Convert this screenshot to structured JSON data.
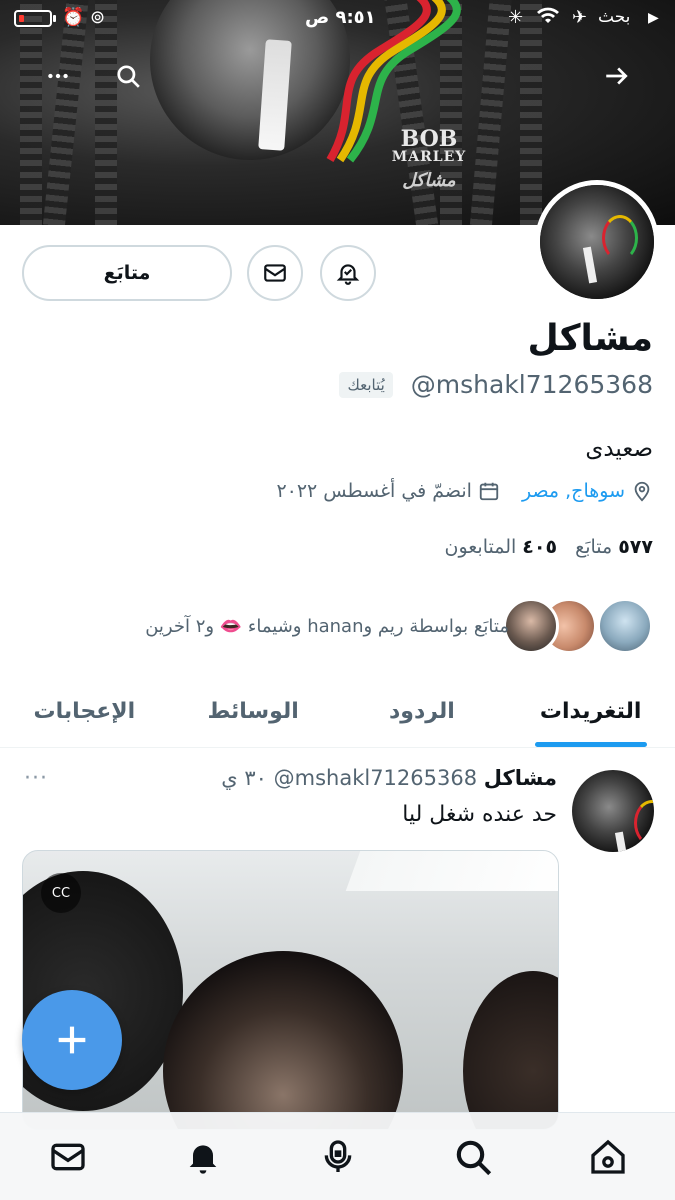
{
  "status_bar": {
    "time": "٩:٥١ ص",
    "carrier": "بحث",
    "battery_icon": "battery-low-icon",
    "alarm_icon": "alarm-icon",
    "orientation_icon": "orientation-lock-icon",
    "wifi_icon": "wifi-icon",
    "airplane_icon": "airplane-icon"
  },
  "banner": {
    "logo_line1": "BOB",
    "logo_line2": "MARLEY",
    "logo_script": "مشاكل"
  },
  "actions": {
    "follow_label": "متابَع"
  },
  "profile": {
    "name": "مشاكل",
    "handle": "@mshakl71265368",
    "follows_you": "يُتابعك",
    "bio": "صعيدى",
    "location": "سوهاج, مصر",
    "joined": "انضمّ في أغسطس ٢٠٢٢",
    "following_count": "٥٧٧",
    "following_label": "متابَع",
    "followers_count": "٤٠٥",
    "followers_label": "المتابعون",
    "followers_you_know": "متابَع بواسطة ريم وhanan وشيماء 👄 و٢ آخرين"
  },
  "tabs": [
    {
      "label": "التغريدات",
      "active": true
    },
    {
      "label": "الردود",
      "active": false
    },
    {
      "label": "الوسائط",
      "active": false
    },
    {
      "label": "الإعجابات",
      "active": false
    }
  ],
  "tweet": {
    "name": "مشاكل",
    "handle": "@mshakl71265368",
    "time": "٣٠ ي",
    "text": "حد عنده شغل ليا",
    "more": "···"
  },
  "colors": {
    "accent": "#1d9bf0",
    "fab": "#4a99e9",
    "secondary_text": "#536471"
  }
}
